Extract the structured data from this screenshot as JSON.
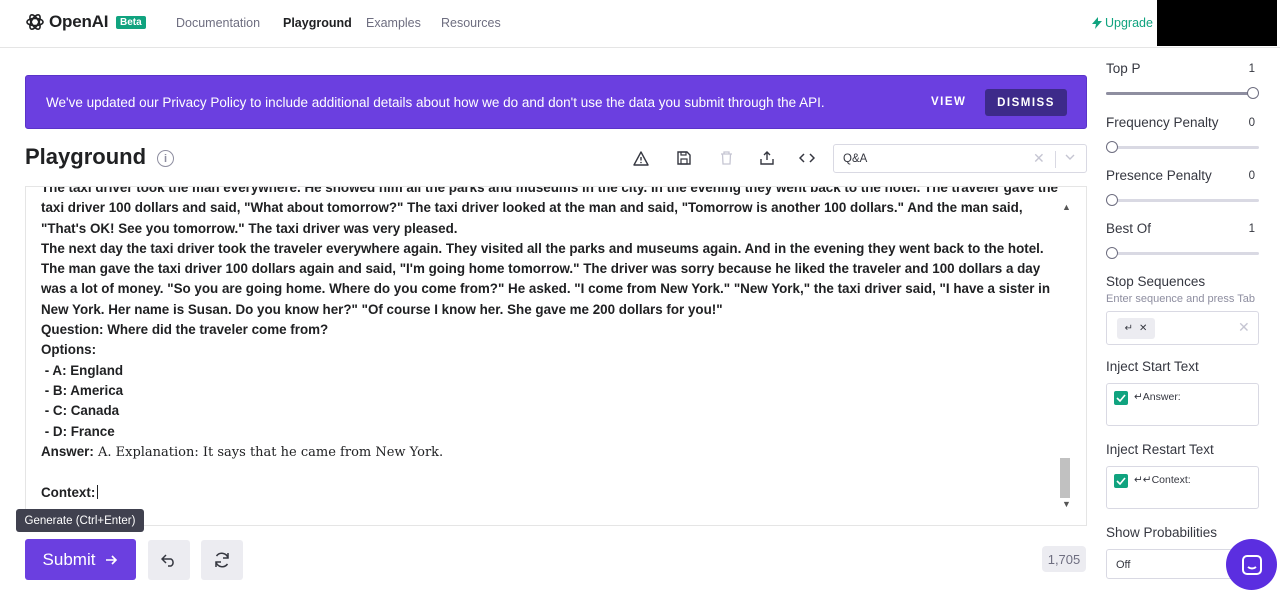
{
  "app": {
    "brand": "OpenAI",
    "beta_badge": "Beta",
    "nav": [
      "Documentation",
      "Playground",
      "Examples",
      "Resources"
    ],
    "active_nav": "Playground",
    "upgrade_label": "Upgrade"
  },
  "banner": {
    "text": "We've updated our Privacy Policy to include additional details about how we do and don't use the data you submit through the API.",
    "view_label": "VIEW",
    "dismiss_label": "DISMISS",
    "color": "#6b3fe0"
  },
  "playground": {
    "title": "Playground",
    "info_icon": "info-icon",
    "toolbar_icons": [
      "warning-icon",
      "save-icon",
      "trash-icon",
      "share-icon",
      "code-icon"
    ],
    "preset_value": "Q&A"
  },
  "editor": {
    "line_partial": "The taxi driver took the man everywhere. He showed him all the parks and museums in the city. In the evening they went back to the hotel. The traveler gave the",
    "para1": "taxi driver 100 dollars and said, \"What about tomorrow?\" The taxi driver looked at the man and said, \"Tomorrow is another 100 dollars.\" And the man said, \"That's OK! See you tomorrow.\" The taxi driver was very pleased.",
    "para2": "The next day the taxi driver took the traveler everywhere again. They visited all the parks and museums again. And in the evening they went back to the hotel. The man gave the taxi driver 100 dollars again and said, \"I'm going home tomorrow.\" The driver was sorry because he liked the traveler and 100 dollars a day was a lot of money. \"So you are going home. Where do you come from?\" He asked. \"I come from New York.\" \"New York,\" the taxi driver said, \"I have a sister in New York. Her name is Susan. Do you know her?\" \"Of course I know her. She gave me 200 dollars for you!\"",
    "question": "Question: Where did the traveler come from?",
    "options_label": "Options:",
    "options": [
      " - A: England",
      " - B: America",
      " - C: Canada",
      " - D: France"
    ],
    "answer_label": "Answer:",
    "answer_text": " A. Explanation: It says that he came from New York.",
    "context_label": "Context:"
  },
  "tooltip": "Generate (Ctrl+Enter)",
  "bottom": {
    "submit_label": "Submit",
    "token_count": "1,705"
  },
  "settings": {
    "top_p": {
      "label": "Top P",
      "value": "1",
      "fraction": 1.0
    },
    "frequency_penalty": {
      "label": "Frequency Penalty",
      "value": "0",
      "fraction": 0.0
    },
    "presence_penalty": {
      "label": "Presence Penalty",
      "value": "0",
      "fraction": 0.0
    },
    "best_of": {
      "label": "Best Of",
      "value": "1",
      "fraction": 0.0
    },
    "stop_sequences": {
      "label": "Stop Sequences",
      "hint": "Enter sequence and press Tab",
      "chip": "↵"
    },
    "inject_start": {
      "label": "Inject Start Text",
      "value": "↵Answer:",
      "checked": true
    },
    "inject_restart": {
      "label": "Inject Restart Text",
      "value": "↵↵Context:",
      "checked": true
    },
    "show_probabilities": {
      "label": "Show Probabilities",
      "value": "Off"
    }
  },
  "colors": {
    "accent": "#10a37f",
    "primary": "#6b3fe0"
  }
}
